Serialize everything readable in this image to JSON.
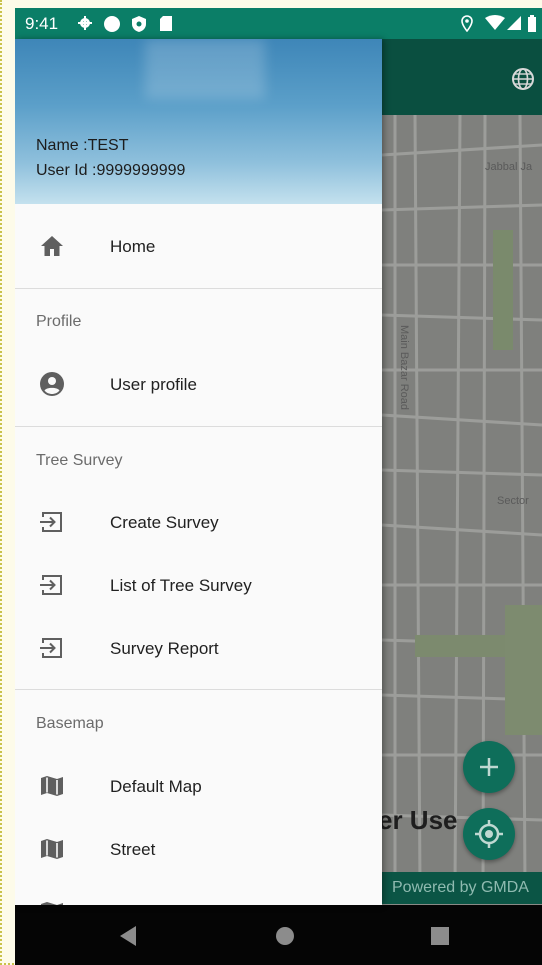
{
  "status_bar": {
    "time": "9:41"
  },
  "map": {
    "label_1": "Jabbal Ja",
    "label_2": "Main Bazar Road",
    "label_3": "Sector",
    "overlay_text": "er Use",
    "powered_by": "Powered by GMDA"
  },
  "drawer": {
    "header": {
      "name_line": "Name :TEST",
      "user_id_line": "User Id :9999999999"
    },
    "home": {
      "label": "Home",
      "icon": "home-icon"
    },
    "sections": {
      "profile": "Profile",
      "tree_survey": "Tree Survey",
      "basemap": "Basemap"
    },
    "items": {
      "user_profile": "User profile",
      "create_survey": "Create Survey",
      "list_tree_survey": "List of Tree Survey",
      "survey_report": "Survey Report",
      "default_map": "Default Map",
      "street": "Street"
    }
  },
  "colors": {
    "status_bar": "#0b7e67",
    "app_bar": "#0a4f40",
    "fab": "#0e6e5a",
    "drawer_bg": "#fafafa"
  }
}
